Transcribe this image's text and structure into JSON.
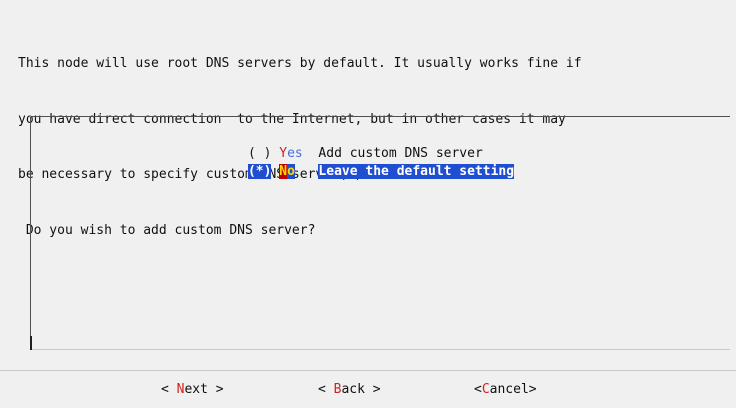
{
  "message": {
    "lines": [
      "This node will use root DNS servers by default. It usually works fine if",
      "you have direct connection  to the Internet, but in other cases it may",
      "be necessary to specify custom DNS server(s).",
      " Do you wish to add custom DNS server?"
    ]
  },
  "options": [
    {
      "marker": "( )",
      "tag_hot": "Y",
      "tag_rest": "es",
      "description": "Add custom DNS server",
      "selected": false
    },
    {
      "marker": "(*)",
      "tag_hot": "N",
      "tag_rest": "o",
      "description": "Leave the default setting",
      "selected": true
    }
  ],
  "buttons": {
    "next": {
      "open": "< ",
      "hot": "N",
      "rest": "ext",
      "close": " >"
    },
    "back": {
      "open": "< ",
      "hot": "B",
      "rest": "ack",
      "close": " >"
    },
    "cancel": {
      "open": "<",
      "hot": "C",
      "rest": "ancel",
      "close": ">"
    }
  },
  "colors": {
    "background": "#f0f0f0",
    "hotkey": "#d22020",
    "selection": "#1f4fd0",
    "selection_hotkey_bg": "#c00000",
    "selection_hotkey_fg": "#ffd800",
    "unselected_tag": "#4a6fd8"
  }
}
